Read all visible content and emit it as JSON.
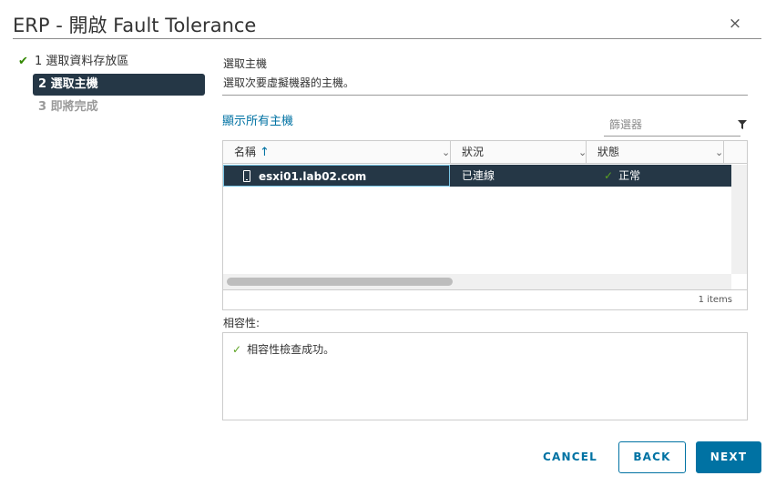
{
  "dialog": {
    "title": "ERP - 開啟 Fault Tolerance",
    "close_glyph": "×"
  },
  "steps": [
    {
      "label": "1 選取資料存放區",
      "state": "done",
      "check": "✔"
    },
    {
      "label": "2 選取主機",
      "state": "active"
    },
    {
      "label": "3 即將完成",
      "state": "pending"
    }
  ],
  "section": {
    "title": "選取主機",
    "description": "選取次要虛擬機器的主機。"
  },
  "show_all_link": "顯示所有主機",
  "filter": {
    "placeholder": "篩選器",
    "icon": "filter-icon"
  },
  "grid": {
    "columns": [
      {
        "label": "名稱",
        "sort_arrow": "↑"
      },
      {
        "label": "狀況"
      },
      {
        "label": "狀態"
      }
    ],
    "rows": [
      {
        "name": "esxi01.lab02.com",
        "condition": "已連線",
        "status": "正常",
        "status_check": "✓"
      }
    ],
    "footer": "1 items"
  },
  "compatibility": {
    "label": "相容性:",
    "message": "相容性檢查成功。",
    "check": "✓"
  },
  "buttons": {
    "cancel": "CANCEL",
    "back": "BACK",
    "next": "NEXT"
  },
  "colors": {
    "accent": "#0072a3",
    "selected_row": "#253746",
    "success": "#318700"
  }
}
